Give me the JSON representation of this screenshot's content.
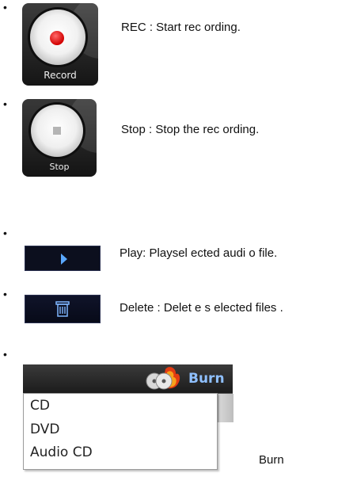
{
  "items": [
    {
      "button_label": "Record",
      "desc": "REC : Start rec ording.",
      "icon": "record-icon"
    },
    {
      "button_label": "Stop",
      "desc": "Stop : Stop the rec ording.",
      "icon": "stop-icon"
    },
    {
      "desc": "Play: Playsel ected audi o file.",
      "icon": "play-icon"
    },
    {
      "desc": "Delete : Delet e s elected files .",
      "icon": "trash-icon"
    },
    {
      "button_label": "Burn",
      "menu": [
        "CD",
        "DVD",
        "Audio CD"
      ],
      "desc": "Burn",
      "icon": "burn-discs-icon"
    }
  ],
  "bullet_char": "•",
  "colors": {
    "record_dot": "#d20000",
    "play_arrow": "#5aa8ff",
    "burn_text": "#8fc0ff",
    "button_bg": "#0c0f1e"
  }
}
